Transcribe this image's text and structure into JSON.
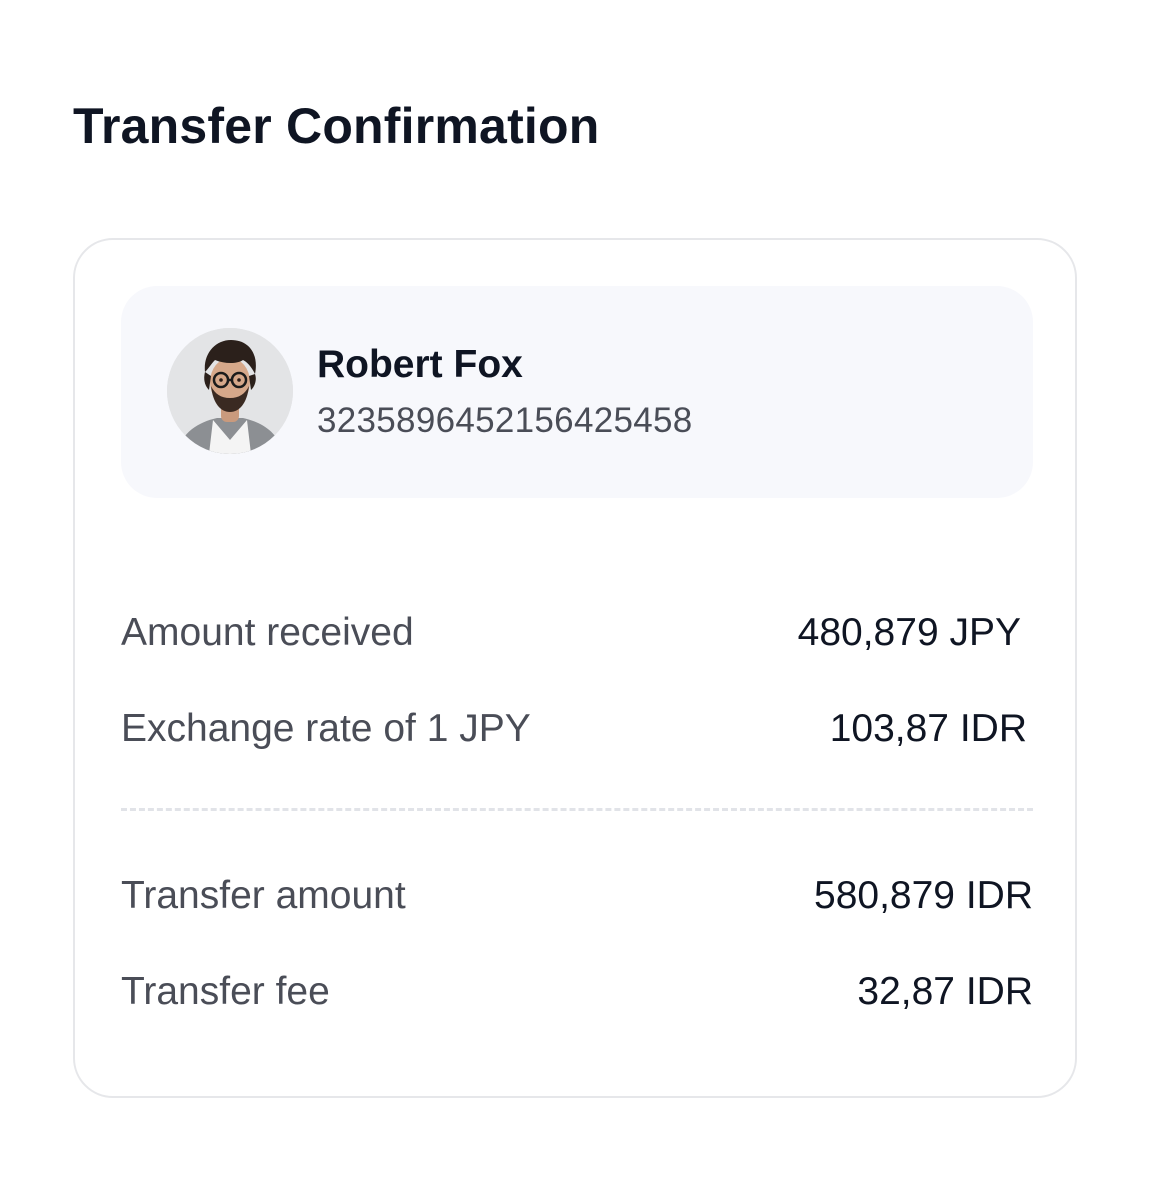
{
  "page": {
    "title": "Transfer Confirmation"
  },
  "recipient": {
    "name": "Robert Fox",
    "account_number": "3235896452156425458",
    "avatar_icon": "person-photo-avatar"
  },
  "details": [
    {
      "label": "Amount received",
      "value": "480,879 JPY"
    },
    {
      "label": "Exchange rate of 1 JPY",
      "value": "103,87 IDR"
    }
  ],
  "totals": [
    {
      "label": "Transfer amount",
      "value": "580,879 IDR"
    },
    {
      "label": "Transfer fee",
      "value": "32,87 IDR"
    }
  ],
  "colors": {
    "text_primary": "#0f1523",
    "text_secondary": "#4a4d57",
    "card_border": "#e6e7ea",
    "recipient_background": "#f7f8fc",
    "divider": "#e1e3e8"
  }
}
